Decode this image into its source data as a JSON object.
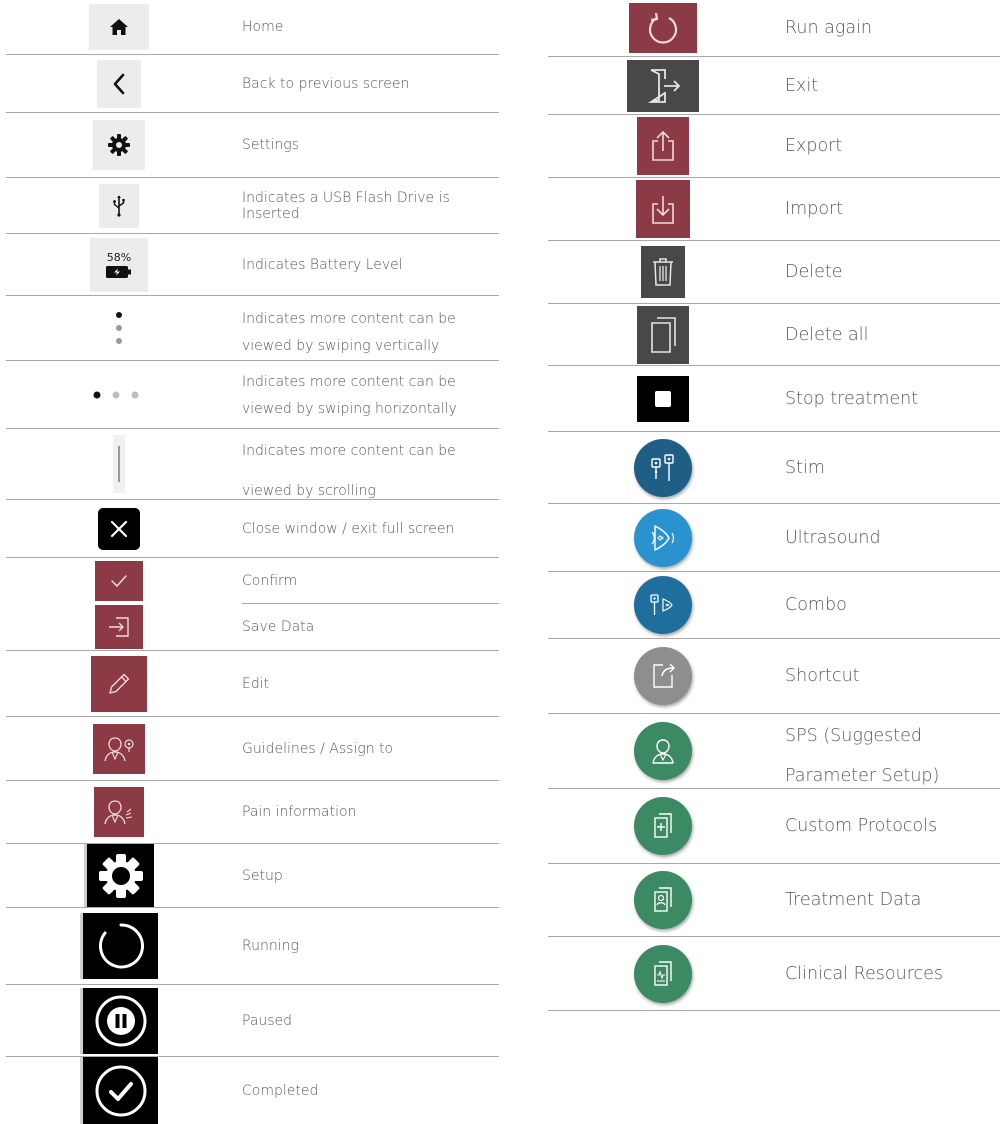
{
  "left": {
    "rows": [
      {
        "id": "home",
        "label": "Home",
        "icon": "home-icon"
      },
      {
        "id": "back",
        "label": "Back to previous screen",
        "icon": "chevron-left-icon"
      },
      {
        "id": "settings",
        "label": "Settings",
        "icon": "gear-icon"
      },
      {
        "id": "usb",
        "label": "Indicates a USB Flash Drive is Inserted",
        "icon": "usb-icon"
      },
      {
        "id": "battery",
        "label": "Indicates Battery Level",
        "icon": "battery-icon",
        "battery_percent": "58%"
      },
      {
        "id": "swipe-v",
        "label_line1": "Indicates more content can be",
        "label_line2": "viewed by swiping vertically",
        "icon": "vertical-dots-icon"
      },
      {
        "id": "swipe-h",
        "label_line1": "Indicates more content can be",
        "label_line2": "viewed by swiping horizontally",
        "icon": "horizontal-dots-icon"
      },
      {
        "id": "scroll",
        "label_line1": "Indicates more content can be",
        "label_line2": "viewed by scrolling",
        "icon": "scrollbar-icon"
      },
      {
        "id": "close",
        "label": "Close window / exit full screen",
        "icon": "close-icon"
      },
      {
        "id": "confirm",
        "label": "Confirm",
        "icon": "checkmark-icon"
      },
      {
        "id": "save",
        "label": "Save Data",
        "icon": "save-data-icon"
      },
      {
        "id": "edit",
        "label": "Edit",
        "icon": "pencil-icon"
      },
      {
        "id": "guidelines",
        "label": "Guidelines / Assign to",
        "icon": "guidelines-icon"
      },
      {
        "id": "pain",
        "label": "Pain information",
        "icon": "pain-info-icon"
      },
      {
        "id": "setup",
        "label": "Setup",
        "icon": "setup-gear-icon"
      },
      {
        "id": "running",
        "label": "Running",
        "icon": "running-icon"
      },
      {
        "id": "paused",
        "label": "Paused",
        "icon": "paused-icon"
      },
      {
        "id": "completed",
        "label": "Completed",
        "icon": "completed-icon"
      }
    ]
  },
  "right": {
    "rows": [
      {
        "id": "run-again",
        "label": "Run again",
        "icon": "refresh-icon"
      },
      {
        "id": "exit",
        "label": "Exit",
        "icon": "exit-door-icon"
      },
      {
        "id": "export",
        "label": "Export",
        "icon": "export-icon"
      },
      {
        "id": "import",
        "label": "Import",
        "icon": "import-icon"
      },
      {
        "id": "delete",
        "label": "Delete",
        "icon": "trash-icon"
      },
      {
        "id": "delete-all",
        "label": "Delete all",
        "icon": "delete-all-icon"
      },
      {
        "id": "stop",
        "label": "Stop treatment",
        "icon": "stop-icon"
      },
      {
        "id": "stim",
        "label": "Stim",
        "icon": "stim-icon"
      },
      {
        "id": "ultrasound",
        "label": "Ultrasound",
        "icon": "ultrasound-icon"
      },
      {
        "id": "combo",
        "label": "Combo",
        "icon": "combo-icon"
      },
      {
        "id": "shortcut",
        "label": "Shortcut",
        "icon": "shortcut-icon"
      },
      {
        "id": "sps",
        "label_line1": "SPS (Suggested",
        "label_line2": "Parameter Setup)",
        "icon": "sps-icon"
      },
      {
        "id": "custom",
        "label": "Custom Protocols",
        "icon": "custom-protocols-icon"
      },
      {
        "id": "treatment",
        "label": "Treatment Data",
        "icon": "treatment-data-icon"
      },
      {
        "id": "clinical",
        "label": "Clinical Resources",
        "icon": "clinical-resources-icon"
      }
    ]
  },
  "colors": {
    "maroon": "#8b3a46",
    "dark_gray": "#4a4749",
    "light_gray_bg": "#ececec",
    "stim_blue": "#1f5f86",
    "ultrasound_blue": "#2a93cf",
    "shortcut_gray": "#8e8e8e",
    "green": "#3c8a63",
    "black": "#000000"
  }
}
